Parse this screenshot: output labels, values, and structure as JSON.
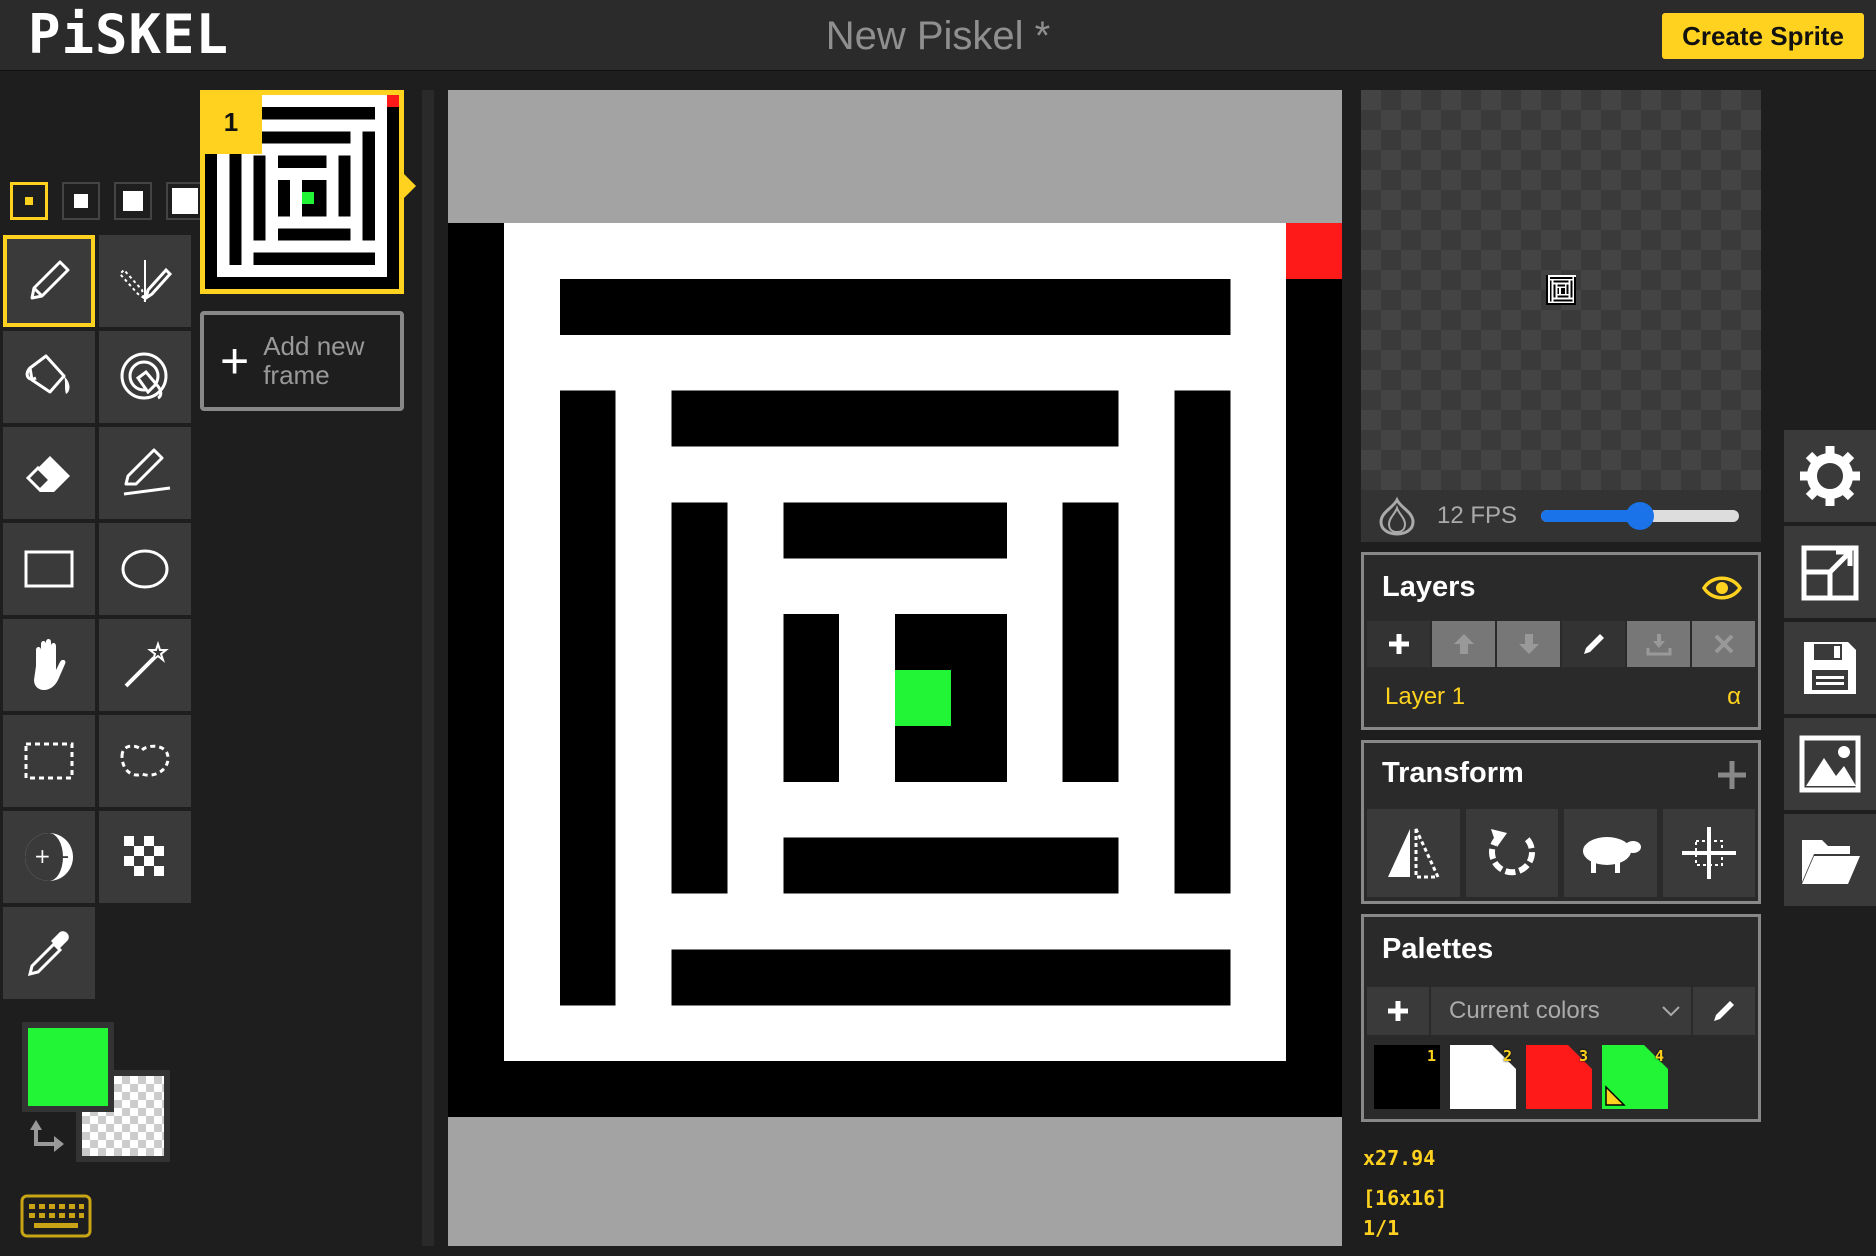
{
  "app": {
    "logo": "PiSKEL",
    "title": "New Piskel *",
    "create_button": "Create Sprite"
  },
  "tools": {
    "pen_sizes": [
      1,
      2,
      3,
      4
    ],
    "selected_pen_size": 1,
    "items": [
      {
        "name": "pen-tool",
        "icon": "pen-icon",
        "selected": true
      },
      {
        "name": "vertical-mirror-pen-tool",
        "icon": "mirror-pen-icon"
      },
      {
        "name": "paint-bucket-tool",
        "icon": "paint-bucket-icon"
      },
      {
        "name": "paint-all-same-color-tool",
        "icon": "paint-same-color-icon"
      },
      {
        "name": "eraser-tool",
        "icon": "eraser-icon"
      },
      {
        "name": "stroke-tool",
        "icon": "stroke-icon"
      },
      {
        "name": "rectangle-tool",
        "icon": "rectangle-icon"
      },
      {
        "name": "circle-tool",
        "icon": "circle-icon"
      },
      {
        "name": "move-tool",
        "icon": "hand-icon"
      },
      {
        "name": "shape-selection-tool",
        "icon": "magic-wand-icon"
      },
      {
        "name": "rectangle-selection-tool",
        "icon": "rect-select-icon"
      },
      {
        "name": "lasso-selection-tool",
        "icon": "lasso-icon"
      },
      {
        "name": "lighten-tool",
        "icon": "lighten-icon"
      },
      {
        "name": "dithering-tool",
        "icon": "dithering-icon"
      },
      {
        "name": "color-picker-tool",
        "icon": "eyedropper-icon"
      }
    ],
    "primary_color": "#22f535",
    "secondary_color": "transparent"
  },
  "frames": {
    "items": [
      {
        "number": "1",
        "selected": true
      }
    ],
    "add_label": "Add new frame"
  },
  "canvas": {
    "size": "16x16",
    "colors": {
      "black": "#000000",
      "white": "#ffffff",
      "red": "#ff1a1a",
      "green": "#22f535"
    }
  },
  "preview": {
    "fps_label": "12 FPS",
    "fps": 12,
    "fps_max": 24
  },
  "layers": {
    "title": "Layers",
    "items": [
      {
        "name": "Layer 1",
        "alpha_label": "α"
      }
    ]
  },
  "transform": {
    "title": "Transform",
    "tools": [
      "flip-icon",
      "rotate-icon",
      "sheep-clone-icon",
      "center-icon"
    ]
  },
  "palettes": {
    "title": "Palettes",
    "selected": "Current colors",
    "swatches": [
      {
        "index": "1",
        "color": "#000000"
      },
      {
        "index": "2",
        "color": "#ffffff"
      },
      {
        "index": "3",
        "color": "#ff1a1a"
      },
      {
        "index": "4",
        "color": "#22f535"
      }
    ]
  },
  "info": {
    "zoom": "x27.94",
    "dimensions": "[16x16]",
    "frame_position": "1/1"
  },
  "side_actions": [
    "gear-icon",
    "resize-icon",
    "save-icon",
    "export-image-icon",
    "open-folder-icon"
  ]
}
